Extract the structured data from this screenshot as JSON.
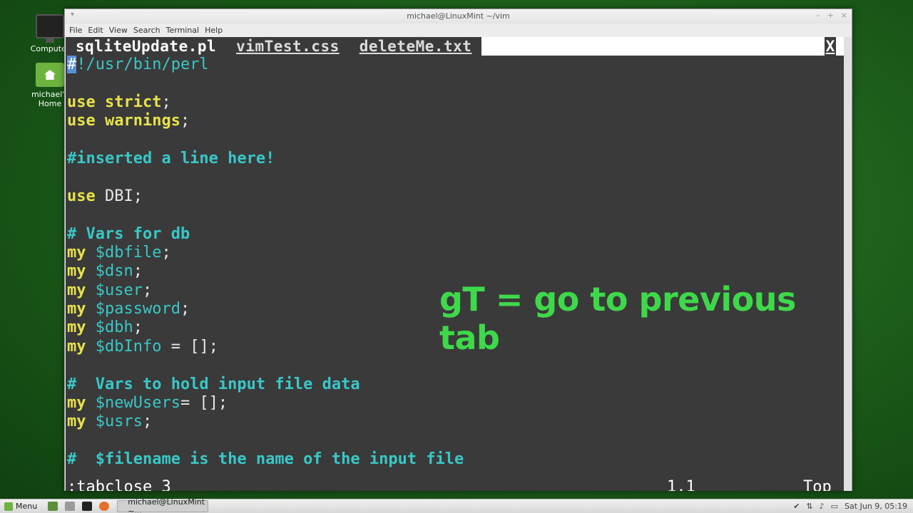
{
  "desktop": {
    "icons": [
      {
        "label": "Computer",
        "icon": "computer-icon"
      },
      {
        "label": "michael's Home",
        "icon": "home-folder-icon"
      }
    ]
  },
  "window": {
    "title": "michael@LinuxMint ~/vim",
    "controls": {
      "minimize": "–",
      "maximize": "+",
      "close": "×"
    },
    "menu": [
      "File",
      "Edit",
      "View",
      "Search",
      "Terminal",
      "Help"
    ]
  },
  "vim": {
    "tabs": [
      {
        "label": "sqliteUpdate.pl",
        "active": true
      },
      {
        "label": "vimTest.css",
        "active": false
      },
      {
        "label": "deleteMe.txt",
        "active": false
      }
    ],
    "tab_close": "X",
    "lines": [
      [
        {
          "t": "#",
          "c": "cursor"
        },
        {
          "t": "!/usr/bin/perl",
          "c": "var"
        }
      ],
      [],
      [
        {
          "t": "use",
          "c": "kw"
        },
        {
          "t": " strict",
          "c": "kw"
        },
        {
          "t": ";",
          "c": "plain"
        }
      ],
      [
        {
          "t": "use",
          "c": "kw"
        },
        {
          "t": " warnings",
          "c": "kw"
        },
        {
          "t": ";",
          "c": "plain"
        }
      ],
      [],
      [
        {
          "t": "#inserted a line here!",
          "c": "cmt"
        }
      ],
      [],
      [
        {
          "t": "use",
          "c": "kw"
        },
        {
          "t": " DBI;",
          "c": "plain"
        }
      ],
      [],
      [
        {
          "t": "# Vars for db",
          "c": "cmt"
        }
      ],
      [
        {
          "t": "my",
          "c": "kw"
        },
        {
          "t": " $dbfile",
          "c": "var"
        },
        {
          "t": ";",
          "c": "plain"
        }
      ],
      [
        {
          "t": "my",
          "c": "kw"
        },
        {
          "t": " $dsn",
          "c": "var"
        },
        {
          "t": ";",
          "c": "plain"
        }
      ],
      [
        {
          "t": "my",
          "c": "kw"
        },
        {
          "t": " $user",
          "c": "var"
        },
        {
          "t": ";",
          "c": "plain"
        }
      ],
      [
        {
          "t": "my",
          "c": "kw"
        },
        {
          "t": " $password",
          "c": "var"
        },
        {
          "t": ";",
          "c": "plain"
        }
      ],
      [
        {
          "t": "my",
          "c": "kw"
        },
        {
          "t": " $dbh",
          "c": "var"
        },
        {
          "t": ";",
          "c": "plain"
        }
      ],
      [
        {
          "t": "my",
          "c": "kw"
        },
        {
          "t": " $dbInfo",
          "c": "var"
        },
        {
          "t": " = [];",
          "c": "plain"
        }
      ],
      [],
      [
        {
          "t": "#  Vars to hold input file data",
          "c": "cmt"
        }
      ],
      [
        {
          "t": "my",
          "c": "kw"
        },
        {
          "t": " $newUsers",
          "c": "var"
        },
        {
          "t": "= [];",
          "c": "plain"
        }
      ],
      [
        {
          "t": "my",
          "c": "kw"
        },
        {
          "t": " $usrs",
          "c": "var"
        },
        {
          "t": ";",
          "c": "plain"
        }
      ],
      [],
      [
        {
          "t": "#  $filename is the name of the input file",
          "c": "cmt"
        }
      ]
    ],
    "command_line": ":tabclose 3",
    "cursor_position": "1,1",
    "scroll_position": "Top"
  },
  "overlay_text": "gT = go to previous tab",
  "taskbar": {
    "menu_label": "Menu",
    "task_label": "michael@LinuxMint ~...",
    "clock": "Sat Jun 9, 05:19"
  },
  "colors": {
    "keyword": "#e8e24a",
    "comment": "#39c7c7",
    "overlay": "#3ed94a",
    "terminal_bg": "#3a3a3a"
  }
}
